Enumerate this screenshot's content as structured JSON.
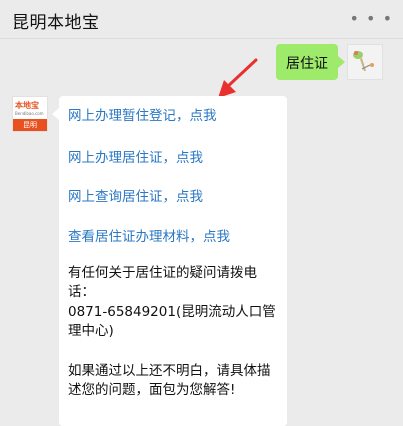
{
  "header": {
    "title": "昆明本地宝",
    "more_label": "• • •"
  },
  "sent_message": {
    "text": "居住证"
  },
  "bot_avatar": {
    "brand": "本地宝",
    "site": "Bendibao.com",
    "city": "昆明"
  },
  "reply": {
    "links": [
      "网上办理暂住登记，点我",
      "网上办理居住证，点我",
      "网上查询居住证，点我",
      "查看居住证办理材料，点我"
    ],
    "paragraph1": "有任何关于居住证的疑问请拨电话：",
    "paragraph2": "0871-65849201(昆明流动人口管理中心)",
    "paragraph3": "如果通过以上还不明白，请具体描述您的问题，面包为您解答!"
  },
  "colors": {
    "sent_bubble": "#9eea6a",
    "link": "#2b78c4",
    "arrow": "#e8312f",
    "brand": "#e8511f"
  }
}
